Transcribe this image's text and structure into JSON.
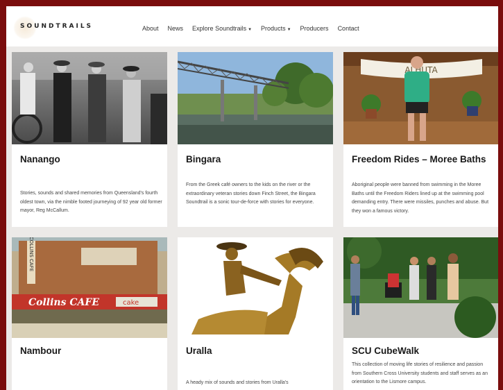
{
  "site": {
    "logo_text": "SOUNDTRAILS"
  },
  "nav": {
    "items": [
      {
        "label": "About"
      },
      {
        "label": "News"
      },
      {
        "label": "Explore Soundtrails",
        "dropdown": true
      },
      {
        "label": "Products",
        "dropdown": true
      },
      {
        "label": "Producers"
      },
      {
        "label": "Contact"
      }
    ]
  },
  "cards": [
    {
      "title": "Nanango",
      "body": "Stories, sounds and shared memories from Queensland's fourth oldest town, via the nimble footed journeying of 92 year old former mayor, Reg McCallum."
    },
    {
      "title": "Bingara",
      "body": "From the Greek café owners to the kids on the river or the extraordinary veteran stories down Finch Street, the Bingara Soundtrail is a sonic tour-de-force with stories for everyone."
    },
    {
      "title": "Freedom Rides – Moree Baths",
      "body": "Aboriginal people were banned from swimming in the Moree Baths until the Freedom Riders lined up at the swimming pool demanding entry. There were missiles, punches and abuse. But they won a famous victory."
    },
    {
      "title": "Nambour",
      "body": ""
    },
    {
      "title": "Uralla",
      "body": "A heady mix of sounds and stories from Uralla's"
    },
    {
      "title": "SCU CubeWalk",
      "body": "This collection of moving life stories of resilience and passion from Southern Cross University students and staff serves as an orientation to the Lismore campus."
    }
  ],
  "image_text": {
    "cafe_sign": "Collins CAFE",
    "cafe_vertical": "COLLINS CAFE",
    "cafe_cake": "cake",
    "banner": "ALHUTA"
  }
}
